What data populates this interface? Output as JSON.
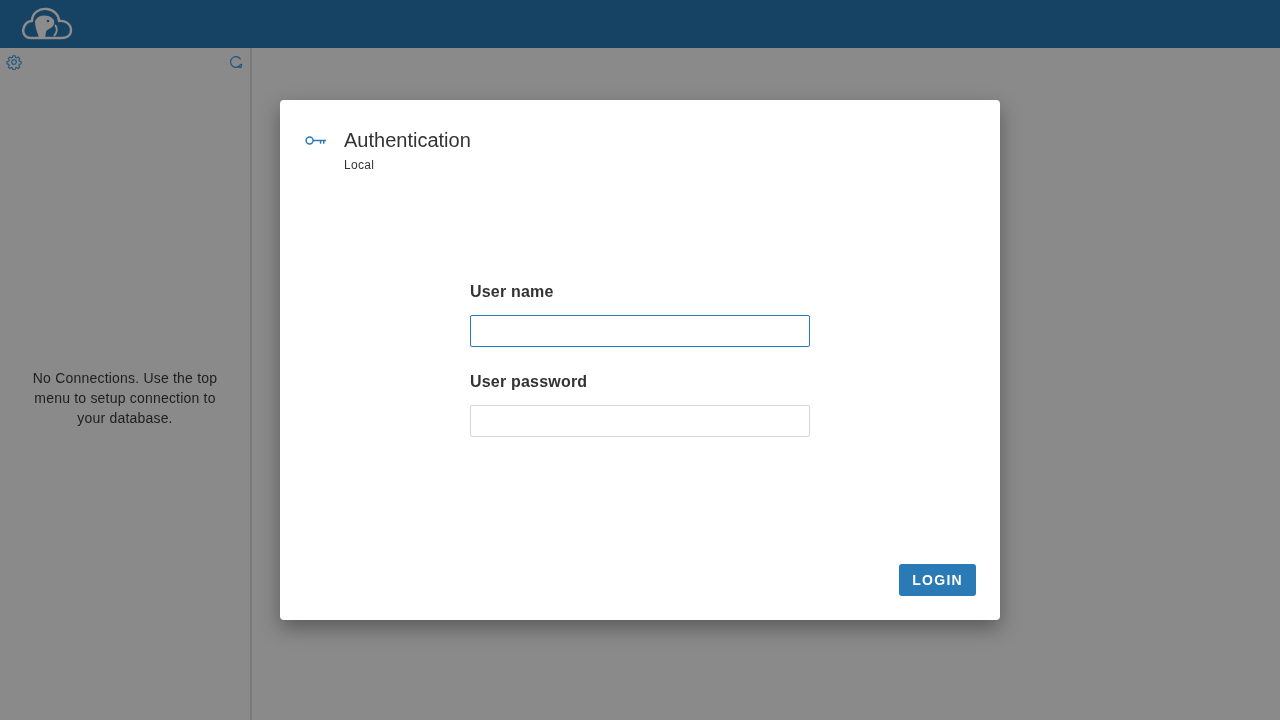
{
  "sidebar": {
    "message": "No Connections. Use the top menu to setup connection to your database."
  },
  "dialog": {
    "title": "Authentication",
    "subtitle": "Local",
    "fields": [
      {
        "label": "User name",
        "focused": true
      },
      {
        "label": "User password",
        "focused": false
      }
    ],
    "buttons": [
      "LOGIN"
    ]
  }
}
